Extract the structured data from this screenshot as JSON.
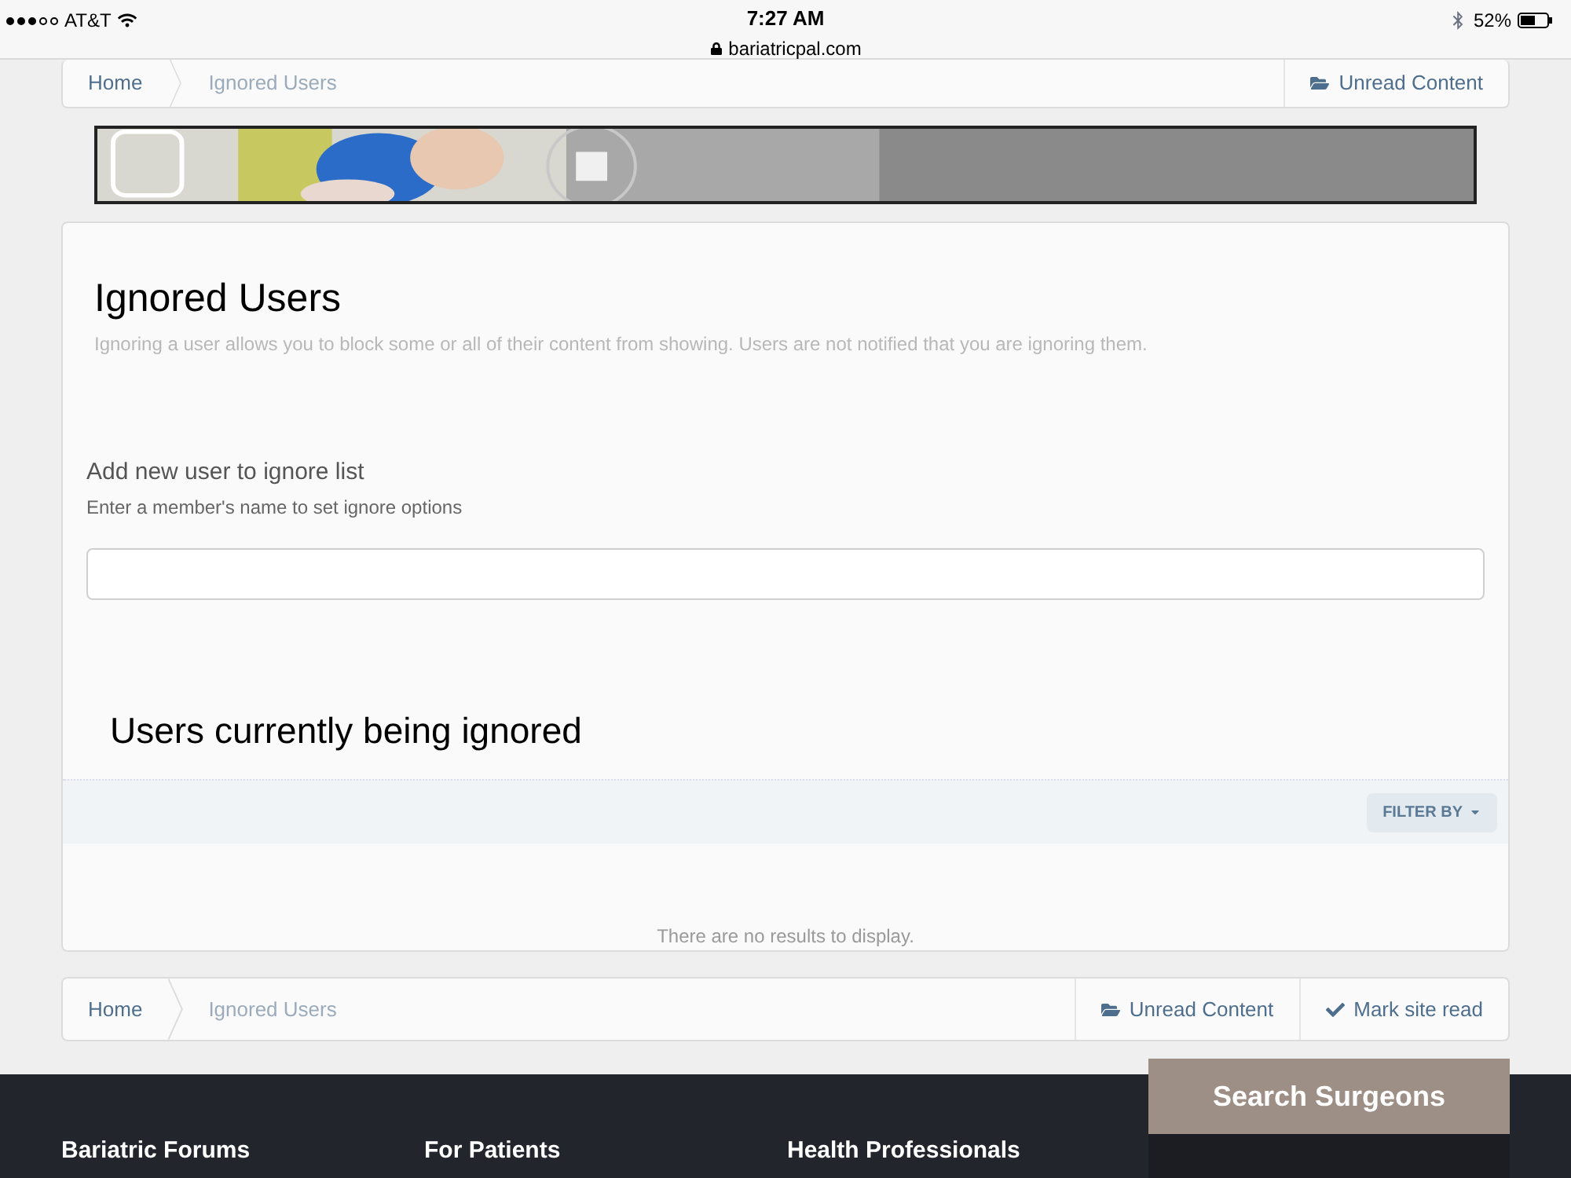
{
  "status_bar": {
    "carrier": "AT&T",
    "time": "7:27 AM",
    "url": "bariatricpal.com",
    "battery": "52%"
  },
  "top_breadcrumb": {
    "items": [
      {
        "label": "Home",
        "kind": "link"
      },
      {
        "label": "Ignored Users",
        "kind": "current"
      }
    ],
    "actions": [
      {
        "label": "Unread Content",
        "kind": "folder"
      }
    ]
  },
  "ignored_users": {
    "title": "Ignored Users",
    "description": "Ignoring a user allows you to block some or all of their content from showing. Users are not notified that you are ignoring them.",
    "field_label": "Add new user to ignore list",
    "field_hint": "Enter a member's name to set ignore options",
    "list_title": "Users currently being ignored",
    "filter_button": "FILTER BY",
    "empty_message": "There are no results to display."
  },
  "bottom_breadcrumb": {
    "items": [
      {
        "label": "Home",
        "kind": "link"
      },
      {
        "label": "Ignored Users",
        "kind": "current"
      }
    ],
    "actions": [
      {
        "label": "Unread Content",
        "kind": "folder"
      },
      {
        "label": "Mark site read",
        "kind": "check"
      }
    ]
  },
  "footer": {
    "search_button": "Search Surgeons",
    "columns": [
      "Bariatric Forums",
      "For Patients",
      "Health Professionals"
    ]
  }
}
